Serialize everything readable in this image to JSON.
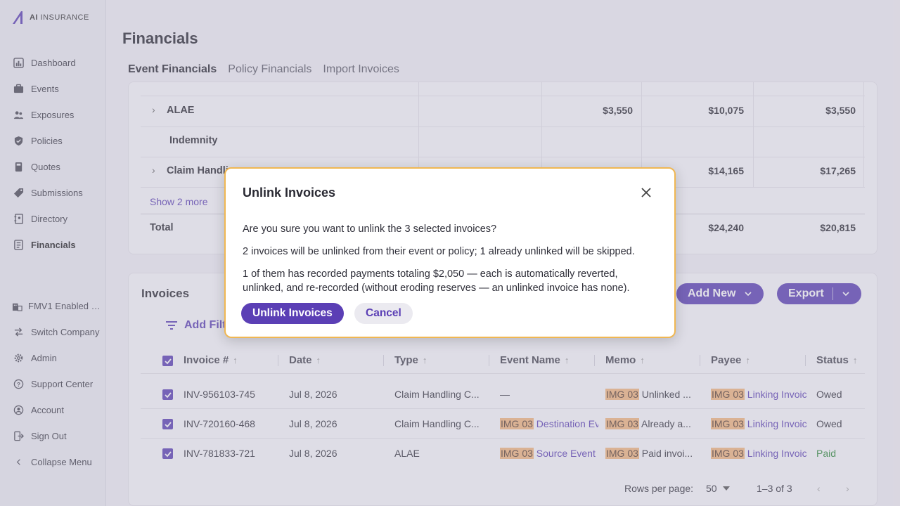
{
  "brand": {
    "logo_bold": "AI",
    "logo_rest": " INSURANCE"
  },
  "sidebar": {
    "items": [
      {
        "label": "Dashboard",
        "icon": "dashboard-icon"
      },
      {
        "label": "Events",
        "icon": "briefcase-icon"
      },
      {
        "label": "Exposures",
        "icon": "people-icon"
      },
      {
        "label": "Policies",
        "icon": "shield-icon"
      },
      {
        "label": "Quotes",
        "icon": "calculator-icon"
      },
      {
        "label": "Submissions",
        "icon": "tag-icon"
      },
      {
        "label": "Directory",
        "icon": "book-icon"
      },
      {
        "label": "Financials",
        "icon": "ledger-icon"
      }
    ],
    "bottom": [
      {
        "label": "FMV1 Enabled …",
        "icon": "building-icon"
      },
      {
        "label": "Switch Company",
        "icon": "switch-icon"
      },
      {
        "label": "Admin",
        "icon": "gear-icon"
      },
      {
        "label": "Support Center",
        "icon": "help-icon"
      },
      {
        "label": "Account",
        "icon": "account-icon"
      },
      {
        "label": "Sign Out",
        "icon": "sign-out-icon"
      },
      {
        "label": "Collapse Menu",
        "icon": "chevron-left-icon"
      }
    ]
  },
  "page": {
    "title": "Financials"
  },
  "tabs": [
    "Event Financials",
    "Policy Financials",
    "Import Invoices"
  ],
  "financials": {
    "rows": [
      {
        "label": "ALAE",
        "c1": "$3,550",
        "c2": "$10,075",
        "c3": "$3,550"
      },
      {
        "label": "Indemnity",
        "c1": "",
        "c2": "",
        "c3": ""
      },
      {
        "label": "Claim Handli",
        "c1": "",
        "c2": "$14,165",
        "c3": "$17,265"
      }
    ],
    "show_more": "Show 2 more",
    "total": {
      "label": "Total",
      "c2": "$24,240",
      "c3": "$20,815"
    }
  },
  "invoices": {
    "title": "Invoices",
    "add_filter": "Add Filt",
    "add_new": "Add New",
    "export": "Export",
    "columns": [
      "Invoice #",
      "Date",
      "Type",
      "Event Name",
      "Memo",
      "Payee",
      "Status"
    ],
    "rows": [
      {
        "invoice": "INV-956103-745",
        "date": "Jul 8, 2026",
        "type": "Claim Handling C...",
        "event_tag": "",
        "event": "—",
        "memo_tag": "IMG 03",
        "memo": " Unlinked ...",
        "payee_tag": "IMG 03",
        "payee": " Linking Invoic",
        "status": "Owed"
      },
      {
        "invoice": "INV-720160-468",
        "date": "Jul 8, 2026",
        "type": "Claim Handling C...",
        "event_tag": "IMG 03",
        "event": " Destination Ev",
        "memo_tag": "IMG 03",
        "memo": " Already a...",
        "payee_tag": "IMG 03",
        "payee": " Linking Invoic",
        "status": "Owed"
      },
      {
        "invoice": "INV-781833-721",
        "date": "Jul 8, 2026",
        "type": "ALAE",
        "event_tag": "IMG 03",
        "event": " Source Event",
        "memo_tag": "IMG 03",
        "memo": " Paid invoi...",
        "payee_tag": "IMG 03",
        "payee": " Linking Invoic",
        "status": "Paid"
      }
    ],
    "rows_per_page_label": "Rows per page:",
    "rows_per_page_value": "50",
    "page_range": "1–3 of 3"
  },
  "modal": {
    "title": "Unlink Invoices",
    "p1": "Are you sure you want to unlink the 3 selected invoices?",
    "p2": "2 invoices will be unlinked from their event or policy; 1 already unlinked will be skipped.",
    "p3": "1 of them has recorded payments totaling $2,050 — each is automatically reverted, unlinked, and re-recorded (without eroding reserves — an unlinked invoice has none).",
    "confirm": "Unlink Invoices",
    "cancel": "Cancel"
  },
  "colors": {
    "accent": "#5b3fb5",
    "tag": "#f4b880",
    "modal_border": "#f0b752",
    "paid": "#2e8b3a"
  }
}
